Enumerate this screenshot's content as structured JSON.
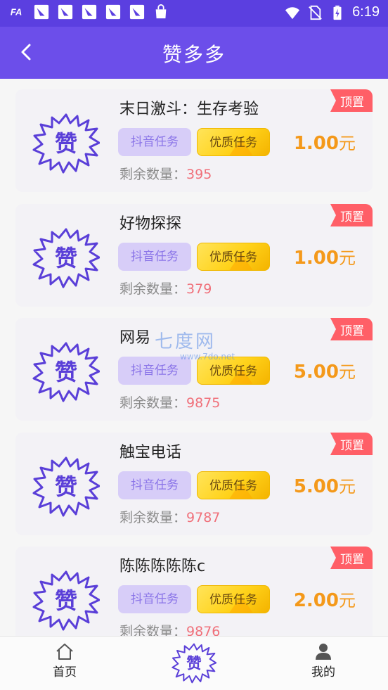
{
  "status_bar": {
    "time": "6:19",
    "left_icons": [
      "font-icon",
      "app-notification-icon",
      "app-notification-icon",
      "app-notification-icon",
      "app-notification-icon",
      "app-notification-icon",
      "shopping-bag-icon"
    ],
    "right_icons": [
      "wifi-icon",
      "no-sim-icon",
      "battery-charging-icon"
    ]
  },
  "header": {
    "title": "赞多多",
    "back_icon": "chevron-left-icon"
  },
  "colors": {
    "brand": "#6c4eea",
    "price": "#f4991a",
    "remain_number": "#f0707a",
    "top_badge": "#ff5f67"
  },
  "labels": {
    "tag_douyin": "抖音任务",
    "tag_quality": "优质任务",
    "remain_label": "剩余数量：",
    "price_unit": "元",
    "top_badge": "顶置"
  },
  "tasks": [
    {
      "name": "末日激斗：生存考验",
      "price": "1.00",
      "remaining": "395"
    },
    {
      "name": "好物探探",
      "price": "1.00",
      "remaining": "379"
    },
    {
      "name": "网易",
      "price": "5.00",
      "remaining": "9875"
    },
    {
      "name": "触宝电话",
      "price": "5.00",
      "remaining": "9787"
    },
    {
      "name": "陈陈陈陈陈c",
      "price": "2.00",
      "remaining": "9876"
    }
  ],
  "watermark": {
    "text": "七度网",
    "sub": "www.7do.net"
  },
  "bottom_nav": {
    "home_label": "首页",
    "home_icon": "home-icon",
    "center_icon": "zan-logo-icon",
    "mine_label": "我的",
    "mine_icon": "user-icon"
  }
}
